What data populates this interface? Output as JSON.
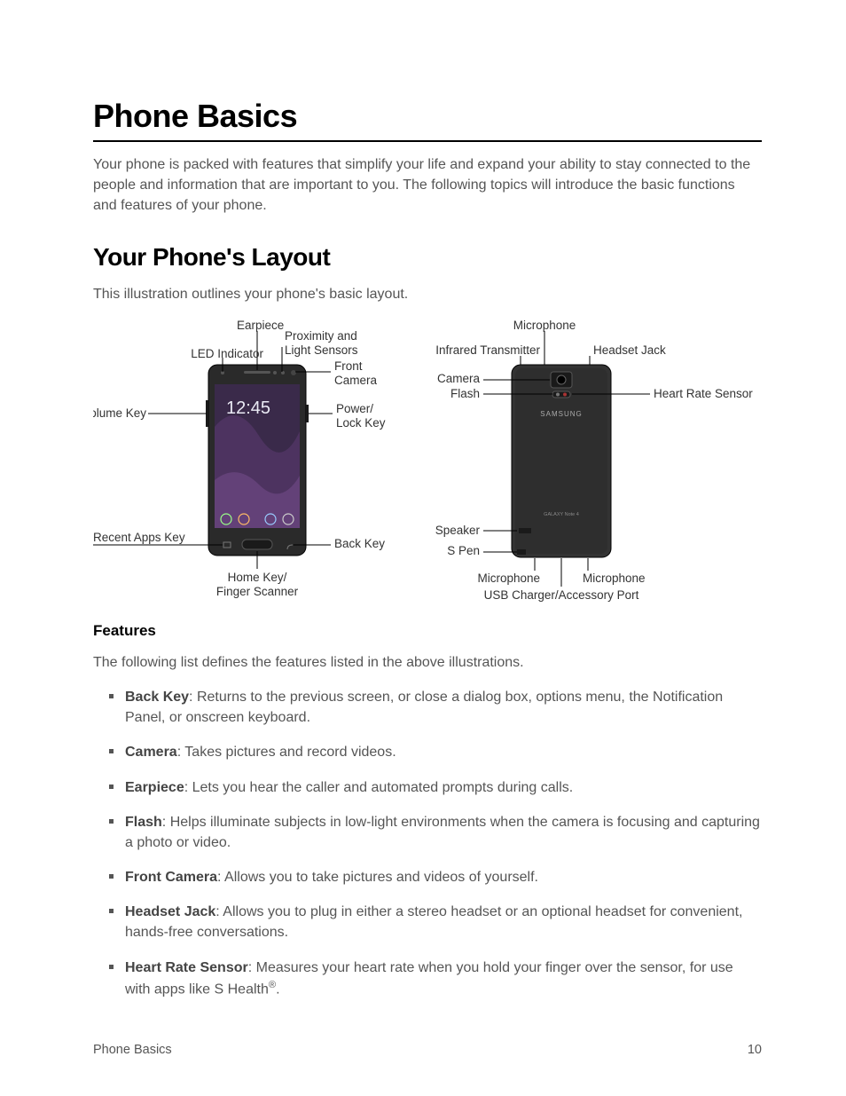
{
  "title": "Phone Basics",
  "intro": "Your phone is packed with features that simplify your life and expand your ability to stay connected to the people and information that are important to you. The following topics will introduce the basic functions and features of your phone.",
  "section_title": "Your Phone's Layout",
  "section_intro": "This illustration outlines your phone's basic layout.",
  "diagram": {
    "front_labels": {
      "earpiece": "Earpiece",
      "led_indicator": "LED Indicator",
      "proximity": "Proximity and",
      "proximity2": "Light Sensors",
      "volume_key": "Volume Key",
      "front_camera": "Front",
      "front_camera2": "Camera",
      "power_lock": "Power/",
      "power_lock2": "Lock Key",
      "recent_apps": "Recent Apps Key",
      "back_key": "Back Key",
      "home_key": "Home Key/",
      "home_key2": "Finger Scanner",
      "clock": "12:45"
    },
    "back_labels": {
      "microphone_top": "Microphone",
      "infrared": "Infrared Transmitter",
      "headset_jack": "Headset Jack",
      "camera": "Camera",
      "flash": "Flash",
      "heart_rate": "Heart Rate Sensor",
      "speaker": "Speaker",
      "s_pen": "S Pen",
      "microphone_bl": "Microphone",
      "microphone_br": "Microphone",
      "usb_port": "USB Charger/Accessory Port",
      "brand": "SAMSUNG",
      "model": "GALAXY Note 4"
    }
  },
  "features_heading": "Features",
  "features_intro": "The following list defines the features listed in the above illustrations.",
  "features": [
    {
      "term": "Back Key",
      "desc_after": ": Returns to the previous screen, or close a dialog box, options menu, the Notification Panel, or onscreen keyboard."
    },
    {
      "term": "Camera",
      "desc_after": ": Takes pictures and record videos."
    },
    {
      "term": "Earpiece",
      "desc_after": ": Lets you hear the caller and automated prompts during calls."
    },
    {
      "term": "Flash",
      "desc_after": ": Helps illuminate subjects in low-light environments when the camera is focusing and capturing a photo or video."
    },
    {
      "term": "Front Camera",
      "desc_after": ": Allows you to take pictures and videos of yourself."
    },
    {
      "term": "Headset Jack",
      "desc_after": ": Allows you to plug in either a stereo headset or an optional headset for convenient, hands-free conversations."
    },
    {
      "term": "Heart Rate Sensor",
      "desc_after": ": Measures your heart rate when you hold your finger over the sensor, for use with apps like S Health",
      "sup": "®",
      "tail": "."
    }
  ],
  "footer_left": "Phone Basics",
  "footer_right": "10"
}
